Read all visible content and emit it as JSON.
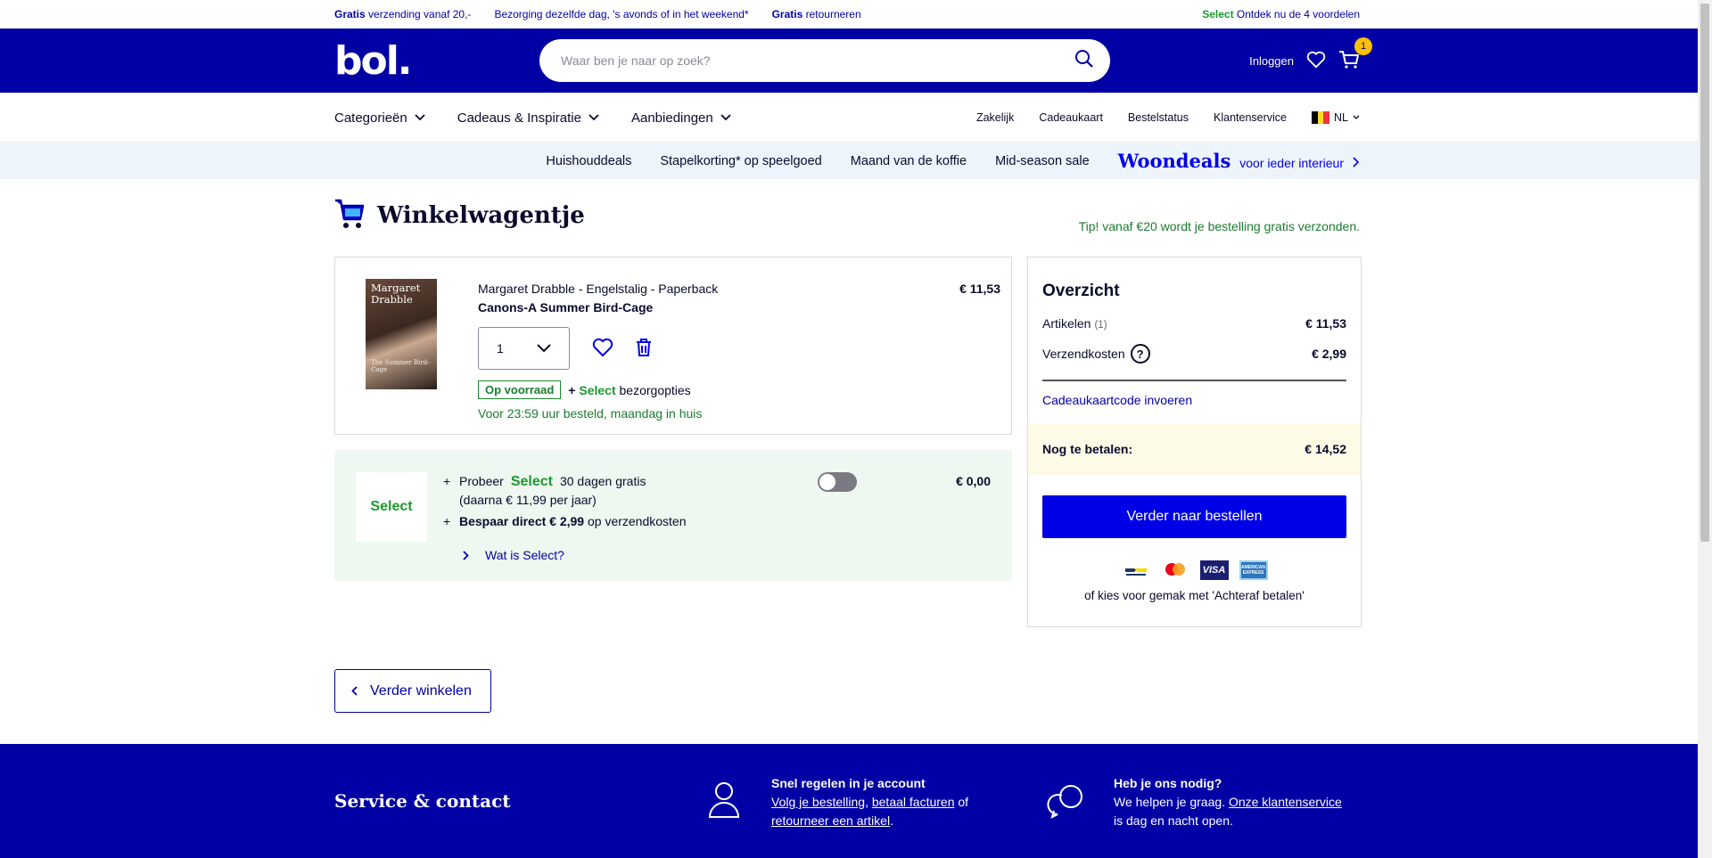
{
  "usp": {
    "items": [
      {
        "bold": "Gratis",
        "text": " verzending vanaf 20,-"
      },
      {
        "bold": "",
        "text": "Bezorging dezelfde dag, 's avonds of in het weekend*"
      },
      {
        "bold": "Gratis",
        "text": " retourneren"
      }
    ],
    "right_bold": "Select",
    "right_text": " Ontdek nu de 4 voordelen"
  },
  "header": {
    "logo": "bol.",
    "search_placeholder": "Waar ben je naar op zoek?",
    "login": "Inloggen",
    "cart_count": "1"
  },
  "nav": {
    "categories": [
      "Categorieën",
      "Cadeaus & Inspiratie",
      "Aanbiedingen"
    ],
    "links": [
      "Zakelijk",
      "Cadeaukaart",
      "Bestelstatus",
      "Klantenservice"
    ],
    "lang": "NL"
  },
  "promo": {
    "items": [
      "Huishouddeals",
      "Stapelkorting* op speelgoed",
      "Maand van de koffie",
      "Mid-season sale"
    ],
    "woondeals": "Woondeals",
    "woondeals_sub": "voor ieder interieur"
  },
  "page": {
    "title": "Winkelwagentje",
    "tip": "Tip! vanaf €20 wordt je bestelling gratis verzonden."
  },
  "product": {
    "cover_author": "Margaret Drabble",
    "cover_title": "The Summer Bird-Cage",
    "meta": "Margaret Drabble - Engelstalig - Paperback",
    "title": "Canons-A Summer Bird-Cage",
    "price": "€ 11,53",
    "qty": "1",
    "stock": "Op voorraad",
    "select_plus": "+",
    "select_word": "Select",
    "select_rest": "bezorgopties",
    "delivery": "Voor 23:59 uur besteld, maandag in huis"
  },
  "select_offer": {
    "logo": "Select",
    "line1_pre": "Probeer",
    "line1_brand": "Select",
    "line1_post": "30 dagen gratis",
    "line1_sub": "(daarna € 11,99 per jaar)",
    "line2_bold": "Bespaar direct € 2,99",
    "line2_rest": " op verzendkosten",
    "link": "Wat is Select?",
    "price": "€ 0,00"
  },
  "overview": {
    "title": "Overzicht",
    "items_label": "Artikelen",
    "items_count": "(1)",
    "items_price": "€ 11,53",
    "shipping_label": "Verzendkosten",
    "shipping_price": "€ 2,99",
    "giftcode": "Cadeaukaartcode invoeren",
    "total_label": "Nog te betalen:",
    "total_price": "€ 14,52",
    "order_button": "Verder naar bestellen",
    "pay_later": "of kies voor gemak met 'Achteraf betalen'",
    "payment_icons": [
      "bancontact-icon",
      "mastercard-icon",
      "visa-icon",
      "amex-icon"
    ],
    "visa": "VISA",
    "amex": "AMERICAN EXPRESS"
  },
  "back_button": "Verder winkelen",
  "footer": {
    "title": "Service & contact",
    "col1_title": "Snel regelen in je account",
    "col1_a": "Volg je bestelling",
    "col1_b": "betaal facturen",
    "col1_of": " of",
    "col1_c": "retourneer een artikel",
    "col2_title": "Heb je ons nodig?",
    "col2_pre": "We helpen je graag. ",
    "col2_link": "Onze klantenservice",
    "col2_post": "is dag en nacht open."
  },
  "colors": {
    "brand_blue": "#0000a4",
    "cta_blue": "#0000e6",
    "select_green": "#1a9a2e",
    "badge_yellow": "#ffc000"
  }
}
